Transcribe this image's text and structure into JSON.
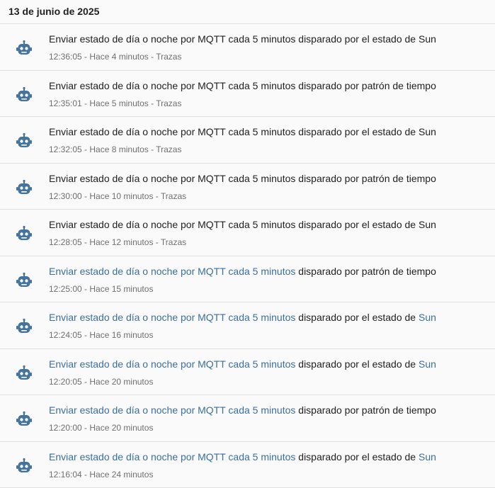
{
  "date_header": "13 de junio de 2025",
  "colors": {
    "icon": "#44739e",
    "link": "#3b6fa0",
    "meta": "#6f6f6f",
    "divider": "#e0e0e0"
  },
  "entries": [
    {
      "icon": "robot-icon",
      "name": "Enviar estado de día o noche por MQTT cada 5 minutos",
      "name_is_link": false,
      "verb": "disparado por",
      "trigger_prefix": "el estado de",
      "trigger_entity": "Sun",
      "time": "12:36:05",
      "ago": "Hace 4 minutos",
      "traces": "Trazas"
    },
    {
      "icon": "robot-icon",
      "name": "Enviar estado de día o noche por MQTT cada 5 minutos",
      "name_is_link": false,
      "verb": "disparado por",
      "trigger_prefix": "patrón de tiempo",
      "trigger_entity": "",
      "time": "12:35:01",
      "ago": "Hace 5 minutos",
      "traces": "Trazas"
    },
    {
      "icon": "robot-icon",
      "name": "Enviar estado de día o noche por MQTT cada 5 minutos",
      "name_is_link": false,
      "verb": "disparado por",
      "trigger_prefix": "el estado de",
      "trigger_entity": "Sun",
      "time": "12:32:05",
      "ago": "Hace 8 minutos",
      "traces": "Trazas"
    },
    {
      "icon": "robot-icon",
      "name": "Enviar estado de día o noche por MQTT cada 5 minutos",
      "name_is_link": false,
      "verb": "disparado por",
      "trigger_prefix": "patrón de tiempo",
      "trigger_entity": "",
      "time": "12:30:00",
      "ago": "Hace 10 minutos",
      "traces": "Trazas"
    },
    {
      "icon": "robot-icon",
      "name": "Enviar estado de día o noche por MQTT cada 5 minutos",
      "name_is_link": false,
      "verb": "disparado por",
      "trigger_prefix": "el estado de",
      "trigger_entity": "Sun",
      "time": "12:28:05",
      "ago": "Hace 12 minutos",
      "traces": "Trazas"
    },
    {
      "icon": "robot-icon",
      "name": "Enviar estado de día o noche por MQTT cada 5 minutos",
      "name_is_link": true,
      "verb": "disparado por",
      "trigger_prefix": "patrón de tiempo",
      "trigger_entity": "",
      "time": "12:25:00",
      "ago": "Hace 15 minutos",
      "traces": ""
    },
    {
      "icon": "robot-icon",
      "name": "Enviar estado de día o noche por MQTT cada 5 minutos",
      "name_is_link": true,
      "verb": "disparado por",
      "trigger_prefix": "el estado de",
      "trigger_entity": "Sun",
      "time": "12:24:05",
      "ago": "Hace 16 minutos",
      "traces": ""
    },
    {
      "icon": "robot-icon",
      "name": "Enviar estado de día o noche por MQTT cada 5 minutos",
      "name_is_link": true,
      "verb": "disparado por",
      "trigger_prefix": "el estado de",
      "trigger_entity": "Sun",
      "time": "12:20:05",
      "ago": "Hace 20 minutos",
      "traces": ""
    },
    {
      "icon": "robot-icon",
      "name": "Enviar estado de día o noche por MQTT cada 5 minutos",
      "name_is_link": true,
      "verb": "disparado por",
      "trigger_prefix": "patrón de tiempo",
      "trigger_entity": "",
      "time": "12:20:00",
      "ago": "Hace 20 minutos",
      "traces": ""
    },
    {
      "icon": "robot-icon",
      "name": "Enviar estado de día o noche por MQTT cada 5 minutos",
      "name_is_link": true,
      "verb": "disparado por",
      "trigger_prefix": "el estado de",
      "trigger_entity": "Sun",
      "time": "12:16:04",
      "ago": "Hace 24 minutos",
      "traces": ""
    }
  ]
}
